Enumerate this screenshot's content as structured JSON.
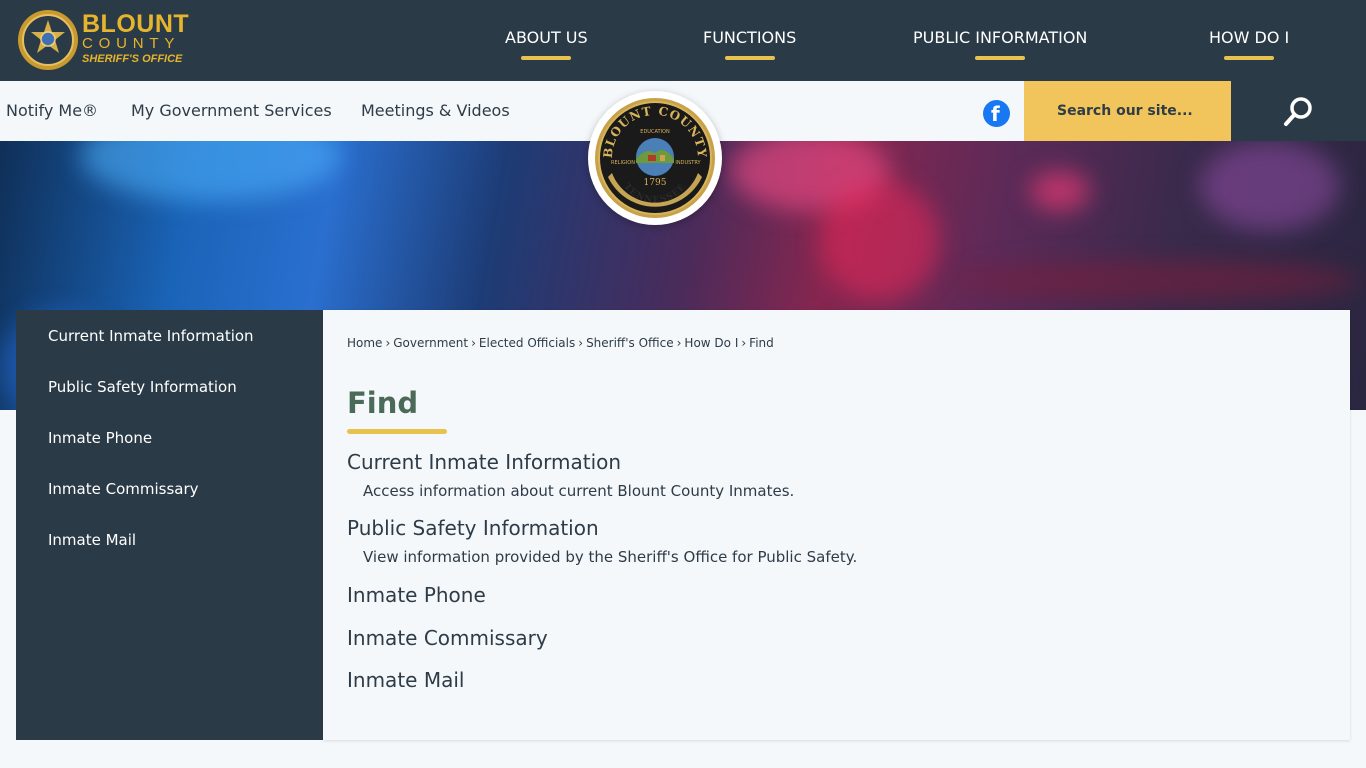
{
  "logo": {
    "line1": "BLOUNT",
    "line2": "COUNTY",
    "line3": "SHERIFF'S OFFICE"
  },
  "main_nav": [
    "ABOUT US",
    "FUNCTIONS",
    "PUBLIC INFORMATION",
    "HOW DO I"
  ],
  "sub_nav": [
    "Notify Me®",
    "My Government Services",
    "Meetings & Videos"
  ],
  "search": {
    "placeholder": "Search our site..."
  },
  "seal": {
    "top_text": "BLOUNT COUNTY",
    "upper_inner": "EDUCATION",
    "left_inner": "RELIGION",
    "right_inner": "INDUSTRY",
    "year": "1795",
    "bottom_text": "TENNESSEE"
  },
  "sidebar": {
    "items": [
      "Current Inmate Information",
      "Public Safety Information",
      "Inmate Phone",
      "Inmate Commissary",
      "Inmate Mail"
    ]
  },
  "breadcrumb": [
    "Home",
    "Government",
    "Elected Officials",
    "Sheriff's Office",
    "How Do I",
    "Find"
  ],
  "page_title": "Find",
  "entries": [
    {
      "title": "Current Inmate Information",
      "desc": "Access information about current Blount County Inmates."
    },
    {
      "title": "Public Safety Information",
      "desc": "View information provided by the Sheriff's Office for Public Safety."
    },
    {
      "title": "Inmate Phone",
      "desc": ""
    },
    {
      "title": "Inmate Commissary",
      "desc": ""
    },
    {
      "title": "Inmate Mail",
      "desc": ""
    }
  ],
  "colors": {
    "header": "#2a3a47",
    "accent": "#e8c24e",
    "search_bg": "#f2c55c",
    "title_green": "#4b6a57",
    "facebook": "#1877f2"
  },
  "icons": {
    "social": "facebook-icon",
    "search": "search-icon",
    "logo": "sheriff-badge-icon"
  }
}
